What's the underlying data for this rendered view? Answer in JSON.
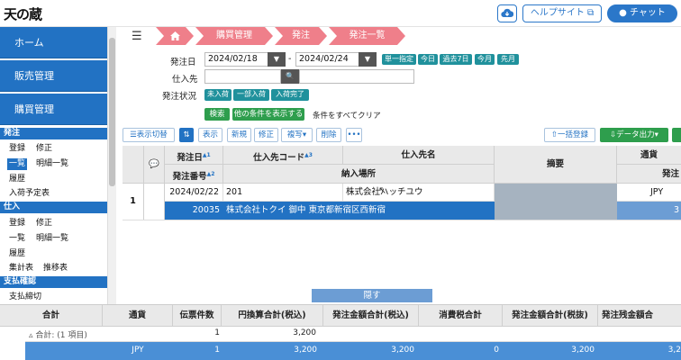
{
  "header": {
    "logo": "天の蔵",
    "help_label": "ヘルプサイト",
    "chat_label": "チャット",
    "cloud_icon": "cloud-download-icon"
  },
  "sidebar": {
    "top_items": [
      "ホーム",
      "販売管理",
      "購買管理"
    ],
    "sections": [
      {
        "title": "発注",
        "rows": [
          [
            "登録",
            "修正"
          ],
          [
            "一覧",
            "明細一覧"
          ],
          [
            "履歴"
          ],
          [
            "入荷予定表"
          ]
        ]
      },
      {
        "title": "仕入",
        "rows": [
          [
            "登録",
            "修正"
          ],
          [
            "一覧",
            "明細一覧"
          ],
          [
            "履歴"
          ],
          [
            "集計表",
            "推移表"
          ]
        ]
      },
      {
        "title": "支払確認",
        "rows": [
          [
            "支払締切"
          ]
        ]
      }
    ]
  },
  "breadcrumb": [
    "購買管理",
    "発注",
    "発注一覧"
  ],
  "filters": {
    "order_date_label": "発注日",
    "date_from": "2024/02/18",
    "date_sep": "-",
    "date_to": "2024/02/24",
    "quick": [
      "単一指定",
      "今日",
      "過去7日",
      "今月",
      "先月"
    ],
    "supplier_label": "仕入先",
    "status_label": "発注状況",
    "status_options": [
      "未入荷",
      "一部入荷",
      "入荷完了"
    ],
    "search_label": "検索",
    "other_cond_label": "他の条件を表示する",
    "clear_label": "条件をすべてクリア"
  },
  "toolbar": {
    "display_toggle": "表示切替",
    "show": "表示",
    "new": "新規",
    "edit": "修正",
    "copy": "複写",
    "delete": "削除",
    "more": "•••",
    "bulk_register": "一括登録",
    "data_output": "データ出力"
  },
  "grid": {
    "headers": {
      "order_date": "発注日",
      "supplier_code": "仕入先コード",
      "supplier_name": "仕入先名",
      "order_no": "発注番号",
      "delivery": "納入場所",
      "summary": "摘要",
      "currency": "通貨",
      "order_prefix": "発注"
    },
    "sort_marks": {
      "order_date": "▲1",
      "supplier_code": "▲3",
      "order_no": "▲2"
    },
    "rows": [
      {
        "num": "1",
        "order_date": "2024/02/22",
        "supplier_code": "201",
        "supplier_name": "株式会社ハッチユウ",
        "currency": "JPY",
        "order_no": "20035",
        "delivery": "株式会社トクイ 御中 東京都新宿区西新宿",
        "trailing": "3"
      }
    ]
  },
  "hide_label": "隠す",
  "summary": {
    "headers": [
      "合計",
      "通貨",
      "伝票件数",
      "円換算合計(税込)",
      "発注金額合計(税込)",
      "消費税合計",
      "発注金額合計(税抜)",
      "発注残金額合"
    ],
    "group": {
      "label": "合計: (1 項目)",
      "count": "1",
      "yen_total": "3,200"
    },
    "total": {
      "currency": "JPY",
      "count": "1",
      "yen_total": "3,200",
      "order_incl": "3,200",
      "tax": "0",
      "order_excl": "3,200",
      "remaining": "3,2"
    }
  }
}
